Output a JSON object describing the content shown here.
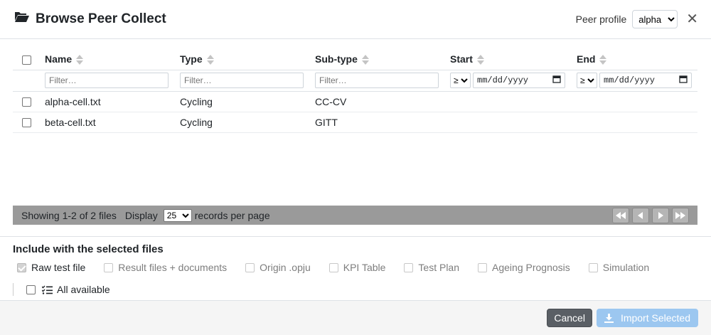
{
  "header": {
    "title": "Browse Peer Collect",
    "profile_label": "Peer profile",
    "profile_value": "alpha",
    "close_glyph": "✕"
  },
  "table": {
    "columns": [
      {
        "label": "Name"
      },
      {
        "label": "Type"
      },
      {
        "label": "Sub-type"
      },
      {
        "label": "Start"
      },
      {
        "label": "End"
      }
    ],
    "filter_placeholder": "Filter…",
    "date_op": "≥",
    "date_placeholder": "mm/dd/yyyy",
    "rows": [
      {
        "name": "alpha-cell.txt",
        "type": "Cycling",
        "subtype": "CC-CV",
        "start": "",
        "end": ""
      },
      {
        "name": "beta-cell.txt",
        "type": "Cycling",
        "subtype": "GITT",
        "start": "",
        "end": ""
      }
    ]
  },
  "pager": {
    "showing": "Showing 1-2 of 2 files",
    "display_label": "Display",
    "per_page_value": "25",
    "per_page_suffix": "records per page"
  },
  "include": {
    "title": "Include with the selected files",
    "options": [
      {
        "label": "Raw test file",
        "checked": true,
        "disabled": false
      },
      {
        "label": "Result files + documents",
        "checked": false,
        "disabled": true
      },
      {
        "label": "Origin .opju",
        "checked": false,
        "disabled": true
      },
      {
        "label": "KPI Table",
        "checked": false,
        "disabled": true
      },
      {
        "label": "Test Plan",
        "checked": false,
        "disabled": true
      },
      {
        "label": "Ageing Prognosis",
        "checked": false,
        "disabled": true
      },
      {
        "label": "Simulation",
        "checked": false,
        "disabled": true
      }
    ],
    "all_available": "All available"
  },
  "footer": {
    "cancel_label": "Cancel",
    "import_label": "Import Selected"
  },
  "colors": {
    "pager_bg": "#9a9a9a",
    "cancel_bg": "#5a5f65",
    "import_bg": "#9cc7f0"
  }
}
